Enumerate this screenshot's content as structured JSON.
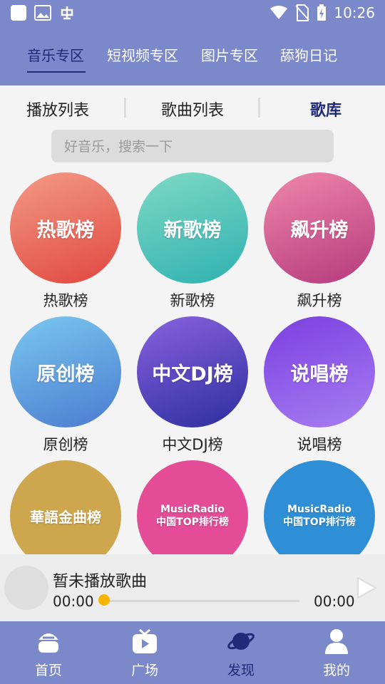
{
  "status_bar": {
    "time": "10:26"
  },
  "top_tabs": [
    "音乐专区",
    "短视频专区",
    "图片专区",
    "舔狗日记"
  ],
  "sub_tabs": [
    "播放列表",
    "歌曲列表",
    "歌库"
  ],
  "search": {
    "placeholder": "好音乐，搜索一下"
  },
  "charts": [
    {
      "title": "热歌榜",
      "label": "热歌榜"
    },
    {
      "title": "新歌榜",
      "label": "新歌榜"
    },
    {
      "title": "飙升榜",
      "label": "飙升榜"
    },
    {
      "title": "原创榜",
      "label": "原创榜"
    },
    {
      "title": "中文DJ榜",
      "label": "中文DJ榜"
    },
    {
      "title": "说唱榜",
      "label": "说唱榜"
    },
    {
      "title": "華語金曲榜",
      "label": ""
    },
    {
      "title": "MusicRadio",
      "subtitle": "中国TOP排行榜",
      "label": ""
    },
    {
      "title": "MusicRadio",
      "subtitle": "中国TOP排行榜",
      "label": ""
    }
  ],
  "player": {
    "song": "暂未播放歌曲",
    "time_current": "00:00",
    "time_total": "00:00",
    "progress": 0
  },
  "bottom_nav": [
    "首页",
    "广场",
    "发现",
    "我的"
  ],
  "colors": {
    "header": "#7b88c9",
    "active": "#1f2a78",
    "progress_knob": "#f7b500"
  }
}
